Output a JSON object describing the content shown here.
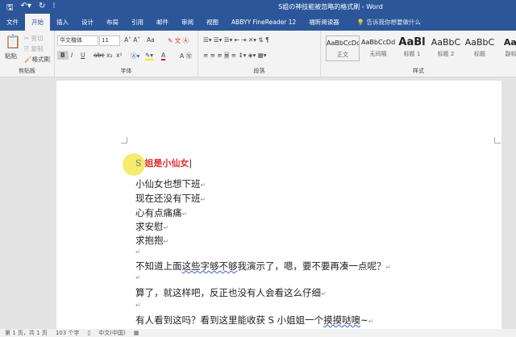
{
  "titlebar": {
    "title": "S姐の神技能被忽略的格式刷 - Word",
    "save_icon": "save-icon",
    "undo_icon": "undo-icon",
    "redo_icon": "redo-icon"
  },
  "tabs": [
    "文件",
    "开始",
    "插入",
    "设计",
    "布局",
    "引用",
    "邮件",
    "审阅",
    "视图",
    "ABBYY FineReader 12",
    "福昕阅读器"
  ],
  "tell_me": "告诉我你想要做什么",
  "clipboard": {
    "paste": "粘贴",
    "cut": "剪切",
    "copy": "复制",
    "format_painter": "格式刷",
    "label": "剪贴板"
  },
  "font": {
    "name": "华文楷体",
    "size": "11",
    "label": "字体",
    "change_case": "Aa",
    "bold": "B",
    "italic": "I",
    "underline": "U",
    "strike": "abc",
    "sub": "x₂",
    "sup": "x²",
    "font_color": "A"
  },
  "paragraph": {
    "label": "段落"
  },
  "styles": {
    "label": "样式",
    "items": [
      {
        "sample": "AaBbCcDd",
        "name": "正文"
      },
      {
        "sample": "AaBbCcDd",
        "name": "无间隔"
      },
      {
        "sample": "AaBl",
        "name": "标题 1"
      },
      {
        "sample": "AaBbC",
        "name": "标题 2"
      },
      {
        "sample": "AaBbC",
        "name": "标题"
      },
      {
        "sample": "AaB",
        "name": "副标题"
      }
    ]
  },
  "document": {
    "heading_s": "S",
    "heading_rest": "姐是小仙女",
    "lines": [
      "小仙女也想下班",
      "现在还没有下班",
      "心有点痛痛",
      "求安慰",
      "求抱抱"
    ],
    "para1_a": "不知道上面",
    "para1_b": "这些字够不够",
    "para1_c": "我演示了，嗯，要不要再凑一点呢？",
    "para2": "算了，就这样吧，反正也没有人会看这么仔细",
    "para3_a": "有人看到这吗？看到这里能收获 S 小姐姐一个",
    "para3_b": "摸摸哒噢",
    "para3_c": "~"
  },
  "status": {
    "page": "第 1 页，共 1 页",
    "words": "103 个字",
    "language": "中文(中国)"
  }
}
